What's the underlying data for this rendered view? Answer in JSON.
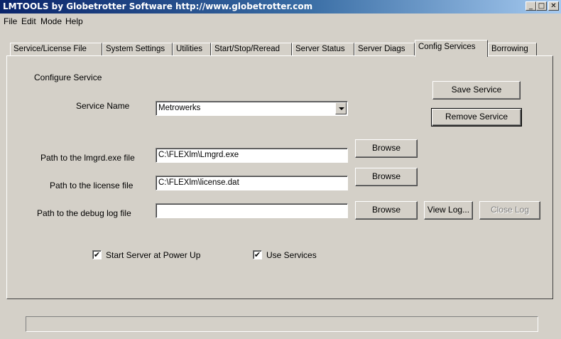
{
  "window": {
    "title": "LMTOOLS by Globetrotter Software http://www.globetrotter.com",
    "controls": {
      "minimize": "_",
      "maximize": "□",
      "close": "✕"
    }
  },
  "menu": [
    "File",
    "Edit",
    "Mode",
    "Help"
  ],
  "tabs": [
    {
      "label": "Service/License File"
    },
    {
      "label": "System Settings"
    },
    {
      "label": "Utilities"
    },
    {
      "label": "Start/Stop/Reread"
    },
    {
      "label": "Server Status"
    },
    {
      "label": "Server Diags"
    },
    {
      "label": "Config Services",
      "active": true
    },
    {
      "label": "Borrowing"
    }
  ],
  "config": {
    "section_label": "Configure Service",
    "service_name_label": "Service Name",
    "service_name_value": "Metrowerks",
    "save_service": "Save Service",
    "remove_service": "Remove Service",
    "lmgrd_label": "Path to the lmgrd.exe file",
    "lmgrd_value": "C:\\FLEXlm\\Lmgrd.exe",
    "license_label": "Path to the license file",
    "license_value": "C:\\FLEXlm\\license.dat",
    "debug_label": "Path to the debug log file",
    "debug_value": "",
    "browse": "Browse",
    "view_log": "View Log...",
    "close_log": "Close Log",
    "start_at_powerup_label": "Start Server at Power Up",
    "start_at_powerup_checked": true,
    "use_services_label": "Use Services",
    "use_services_checked": true
  },
  "status_text": ""
}
